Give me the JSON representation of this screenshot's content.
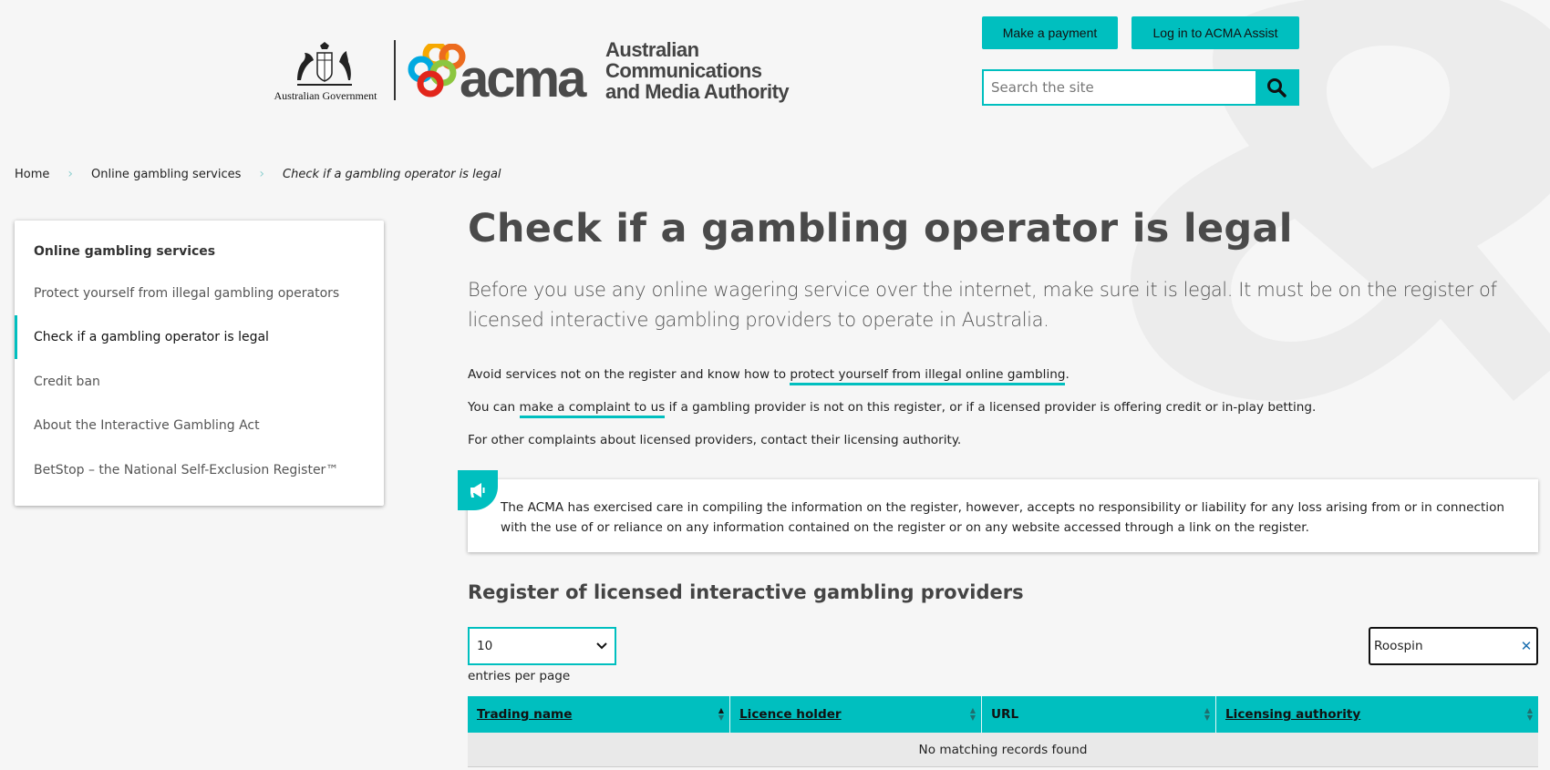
{
  "header": {
    "gov_text": "Australian Government",
    "acma_word": "acma",
    "acma_full": [
      "Australian",
      "Communications",
      "and Media Authority"
    ],
    "make_payment": "Make a payment",
    "login": "Log in to ACMA Assist",
    "search_placeholder": "Search the site",
    "accent_color": "#00bfbf"
  },
  "breadcrumb": {
    "items": [
      "Home",
      "Online gambling services"
    ],
    "current": "Check if a gambling operator is legal"
  },
  "sidebar": {
    "title": "Online gambling services",
    "items": [
      {
        "label": "Protect yourself from illegal gambling operators"
      },
      {
        "label": "Check if a gambling operator is legal",
        "active": true
      },
      {
        "label": "Credit ban"
      },
      {
        "label": "About the Interactive Gambling Act"
      },
      {
        "label": "BetStop – the National Self-Exclusion Register™"
      }
    ]
  },
  "main": {
    "title": "Check if a gambling operator is legal",
    "lead": "Before you use any online wagering service over the internet, make sure it is legal. It must be on the register of licensed interactive gambling providers to operate in Australia.",
    "p1_before": "Avoid services not on the register and know how to ",
    "p1_link": "protect yourself from illegal online gambling",
    "p1_after": ".",
    "p2_before": "You can ",
    "p2_link": "make a complaint to us",
    "p2_after": " if a gambling provider is not on this register, or if a licensed provider is offering credit or in-play betting.",
    "p3": "For other complaints about licensed providers, contact their licensing authority.",
    "notice": "The ACMA has exercised care in compiling the information on the register, however, accepts no responsibility or liability for any loss arising from or in connection with the use of or reliance on any information contained on the register or on any website accessed through a link on the register.",
    "register_title": "Register of licensed interactive gambling providers",
    "entries_value": "10",
    "entries_label": "entries per page",
    "filter_value": "Roospin",
    "table": {
      "columns": [
        {
          "label": "Trading name",
          "sorted": "asc"
        },
        {
          "label": "Licence holder"
        },
        {
          "label": "URL"
        },
        {
          "label": "Licensing authority"
        }
      ],
      "empty_message": "No matching records found"
    }
  }
}
